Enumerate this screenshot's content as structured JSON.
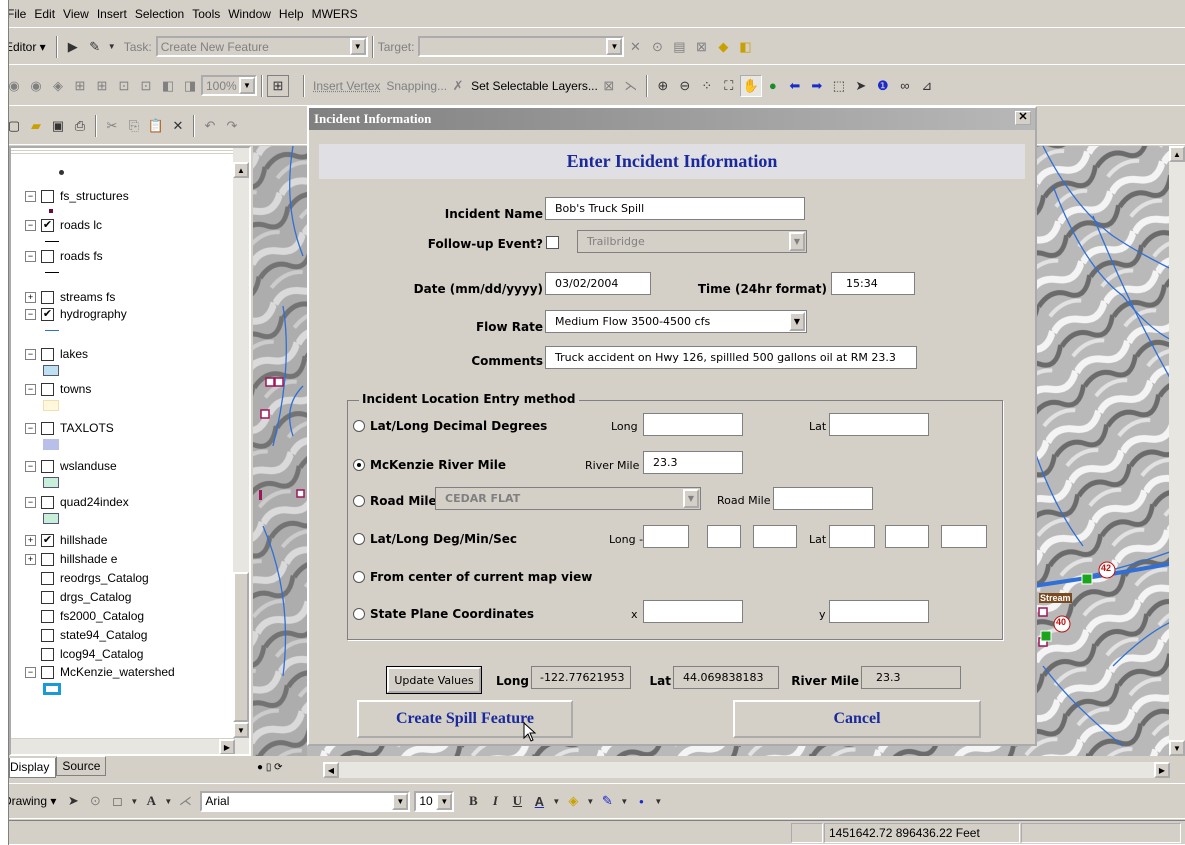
{
  "menu": [
    "File",
    "Edit",
    "View",
    "Insert",
    "Selection",
    "Tools",
    "Window",
    "Help",
    "MWERS"
  ],
  "editor_toolbar": {
    "editor_label": "Editor ▾",
    "task_label": "Task:",
    "task_value": "Create New Feature",
    "target_label": "Target:",
    "target_value": ""
  },
  "nav_toolbar": {
    "zoom_value": "100%",
    "insert_vertex": "Insert Vertex",
    "snapping": "Snapping...",
    "set_selectable": "Set Selectable Layers..."
  },
  "toc": {
    "tabs": [
      "Display",
      "Source"
    ],
    "layers": [
      {
        "name": "fs_structures",
        "checked": false,
        "expand": "−"
      },
      {
        "name": "roads lc",
        "checked": true,
        "expand": "−"
      },
      {
        "name": "roads fs",
        "checked": false,
        "expand": "−"
      },
      {
        "name": "streams fs",
        "checked": false,
        "expand": "+"
      },
      {
        "name": "hydrography",
        "checked": true,
        "expand": "−"
      },
      {
        "name": "lakes",
        "checked": false,
        "expand": "−"
      },
      {
        "name": "towns",
        "checked": false,
        "expand": "−"
      },
      {
        "name": "TAXLOTS",
        "checked": false,
        "expand": "−"
      },
      {
        "name": "wslanduse",
        "checked": false,
        "expand": "−"
      },
      {
        "name": "quad24index",
        "checked": false,
        "expand": "−"
      },
      {
        "name": "hillshade",
        "checked": true,
        "expand": "+"
      },
      {
        "name": "hillshade e",
        "checked": false,
        "expand": "+"
      },
      {
        "name": "reodrgs_Catalog",
        "checked": false,
        "expand": ""
      },
      {
        "name": "drgs_Catalog",
        "checked": false,
        "expand": ""
      },
      {
        "name": "fs2000_Catalog",
        "checked": false,
        "expand": ""
      },
      {
        "name": "state94_Catalog",
        "checked": false,
        "expand": ""
      },
      {
        "name": "lcog94_Catalog",
        "checked": false,
        "expand": ""
      },
      {
        "name": "McKenzie_watershed",
        "checked": false,
        "expand": "−"
      }
    ]
  },
  "map": {
    "labels": [
      "42",
      "40",
      "Stream"
    ]
  },
  "dialog": {
    "title": "Incident Information",
    "heading": "Enter Incident Information",
    "incident_name_label": "Incident Name",
    "incident_name": "Bob's Truck Spill",
    "followup_label": "Follow-up Event?",
    "followup_value": "Trailbridge",
    "date_label": "Date (mm/dd/yyyy)",
    "date": "03/02/2004",
    "time_label": "Time (24hr format)",
    "time": "15:34",
    "flow_label": "Flow Rate",
    "flow": "Medium Flow 3500-4500 cfs",
    "comments_label": "Comments",
    "comments": "Truck accident on Hwy 126, spillled 500 gallons oil at RM 23.3",
    "group_title": "Incident Location Entry method",
    "methods": {
      "latlong_dd": "Lat/Long Decimal Degrees",
      "river_mile": "McKenzie River Mile",
      "road_mile": "Road Mile",
      "latlong_dms": "Lat/Long Deg/Min/Sec",
      "center": "From center of current map view",
      "state_plane": "State Plane Coordinates"
    },
    "selected_method": "river_mile",
    "long_label": "Long",
    "lat_label": "Lat",
    "river_mile_label": "River Mile",
    "river_mile_value": "23.3",
    "road_value": "CEDAR FLAT",
    "road_mile_label": "Road Mile",
    "dms_long_label": "Long -",
    "x_label": "x",
    "y_label": "y",
    "update_button": "Update Values",
    "out_long_label": "Long",
    "out_long": "-122.77621953",
    "out_lat_label": "Lat",
    "out_lat": "44.069838183",
    "out_rm_label": "River Mile",
    "out_rm": "23.3",
    "create_button": "Create Spill Feature",
    "cancel_button": "Cancel"
  },
  "drawing_toolbar": {
    "label": "Drawing ▾",
    "font": "Arial",
    "size": "10",
    "bold": "B",
    "italic": "I",
    "underline": "U",
    "text_color": "A"
  },
  "status": {
    "coords": "1451642.72  896436.22 Feet"
  }
}
